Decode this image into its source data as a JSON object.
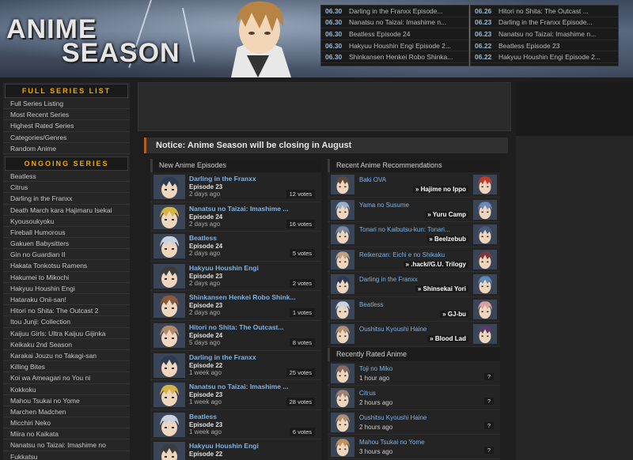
{
  "logo": {
    "line1": "ANIME",
    "line2": "SEASON"
  },
  "updates_left": [
    {
      "date": "06.30",
      "title": "Darling in the Franxx Episode..."
    },
    {
      "date": "06.30",
      "title": "Nanatsu no Taizai: Imashime n..."
    },
    {
      "date": "06.30",
      "title": "Beatless Episode 24"
    },
    {
      "date": "06.30",
      "title": "Hakyuu Houshin Engi Episode 2..."
    },
    {
      "date": "06.30",
      "title": "Shinkansen Henkei Robo Shinka..."
    }
  ],
  "updates_right": [
    {
      "date": "06.26",
      "title": "Hitori no Shita: The Outcast ..."
    },
    {
      "date": "06.23",
      "title": "Darling in the Franxx Episode..."
    },
    {
      "date": "06.23",
      "title": "Nanatsu no Taizai: Imashime n..."
    },
    {
      "date": "06.22",
      "title": "Beatless Episode 23"
    },
    {
      "date": "06.22",
      "title": "Hakyuu Houshin Engi Episode 2..."
    }
  ],
  "sidebar": {
    "full_heading": "FULL SERIES LIST",
    "full_items": [
      "Full Series Listing",
      "Most Recent Series",
      "Highest Rated Series",
      "Categories/Genres",
      "Random Anime"
    ],
    "ongoing_heading": "ONGOING SERIES",
    "ongoing_items": [
      "Beatless",
      "Citrus",
      "Darling in the Franxx",
      "Death March kara Hajimaru Isekai",
      "Kyousoukyoku",
      "Fireball Humorous",
      "Gakuen Babysitters",
      "Gin no Guardian II",
      "Hakata Tonkotsu Ramens",
      "Hakumei to Mikochi",
      "Hakyuu Houshin Engi",
      "Hataraku Onii-san!",
      "Hitori no Shita: The Outcast 2",
      "Itou Junji: Collection",
      "Kaijuu Girls: Ultra Kaijuu Gijinka",
      "Keikaku 2nd Season",
      "Karakai Jouzu no Takagi-san",
      "Killing Bites",
      "Koi wa Ameagari no You ni",
      "Kokkoku",
      "Mahou Tsukai no Yome",
      "Marchen Madchen",
      "Micchiri Neko",
      "Miira no Kaikata",
      "Nanatsu no Taizai: Imashime no",
      "Fukkatsu"
    ]
  },
  "notice": "Notice: Anime Season will be closing in August",
  "new_episodes": {
    "heading": "New Anime Episodes",
    "items": [
      {
        "title": "Darling in the Franxx",
        "episode": "Episode 23",
        "ago": "2 days ago",
        "votes": "12 votes",
        "color": "#2c3a52"
      },
      {
        "title": "Nanatsu no Taizai: Imashime ...",
        "episode": "Episode 24",
        "ago": "2 days ago",
        "votes": "16 votes",
        "color": "#d6b445"
      },
      {
        "title": "Beatless",
        "episode": "Episode 24",
        "ago": "2 days ago",
        "votes": "5 votes",
        "color": "#c8d2e0"
      },
      {
        "title": "Hakyuu Houshin Engi",
        "episode": "Episode 23",
        "ago": "2 days ago",
        "votes": "2 votes",
        "color": "#3c3c3c"
      },
      {
        "title": "Shinkansen Henkei Robo Shink...",
        "episode": "Episode 23",
        "ago": "2 days ago",
        "votes": "1 votes",
        "color": "#8a5a3a"
      },
      {
        "title": "Hitori no Shita: The Outcast...",
        "episode": "Episode 24",
        "ago": "5 days ago",
        "votes": "8 votes",
        "color": "#b08a6a"
      },
      {
        "title": "Darling in the Franxx",
        "episode": "Episode 22",
        "ago": "1 week ago",
        "votes": "25 votes",
        "color": "#2c3a52"
      },
      {
        "title": "Nanatsu no Taizai: Imashime ...",
        "episode": "Episode 23",
        "ago": "1 week ago",
        "votes": "28 votes",
        "color": "#d6b445"
      },
      {
        "title": "Beatless",
        "episode": "Episode 23",
        "ago": "1 week ago",
        "votes": "6 votes",
        "color": "#c8d2e0"
      },
      {
        "title": "Hakyuu Houshin Engi",
        "episode": "Episode 22",
        "ago": "",
        "votes": "",
        "color": "#3c3c3c"
      }
    ]
  },
  "recommendations": {
    "heading": "Recent Anime Recommendations",
    "items": [
      {
        "left": "Baki OVA",
        "right": "» Hajime no Ippo",
        "c1": "#5a4a3a",
        "c2": "#c23a2a"
      },
      {
        "left": "Yama no Susume",
        "right": "» Yuru Camp",
        "c1": "#9ab0c8",
        "c2": "#6a8ab8"
      },
      {
        "left": "Tonari no Kaibutsu-kun: Tonari...",
        "right": "» Beelzebub",
        "c1": "#7a8a9a",
        "c2": "#4a5a7a"
      },
      {
        "left": "Reikenzan: Eichi e no Shikaku",
        "right": "» .hack//G.U. Trilogy",
        "c1": "#c0a080",
        "c2": "#7a3a3a"
      },
      {
        "left": "Darling in the Franxx",
        "right": "» Shinsekai Yori",
        "c1": "#2c3a52",
        "c2": "#5a8ab8"
      },
      {
        "left": "Beatless",
        "right": "» GJ-bu",
        "c1": "#c8d2e0",
        "c2": "#d8a0a0"
      },
      {
        "left": "Oushitsu Kyoushi Haine",
        "right": "» Blood Lad",
        "c1": "#b09070",
        "c2": "#5a3a6a"
      }
    ]
  },
  "recently_rated": {
    "heading": "Recently Rated Anime",
    "items": [
      {
        "name": "Toji no Miko",
        "ago": "1 hour ago",
        "mark": "?",
        "color": "#8a6a5a"
      },
      {
        "name": "Citrus",
        "ago": "2 hours ago",
        "mark": "?",
        "color": "#a08070"
      },
      {
        "name": "Oushitsu Kyoushi Haine",
        "ago": "2 hours ago",
        "mark": "?",
        "color": "#b09070"
      },
      {
        "name": "Mahou Tsukai no Yome",
        "ago": "3 hours ago",
        "mark": "?",
        "color": "#c09060"
      }
    ]
  }
}
